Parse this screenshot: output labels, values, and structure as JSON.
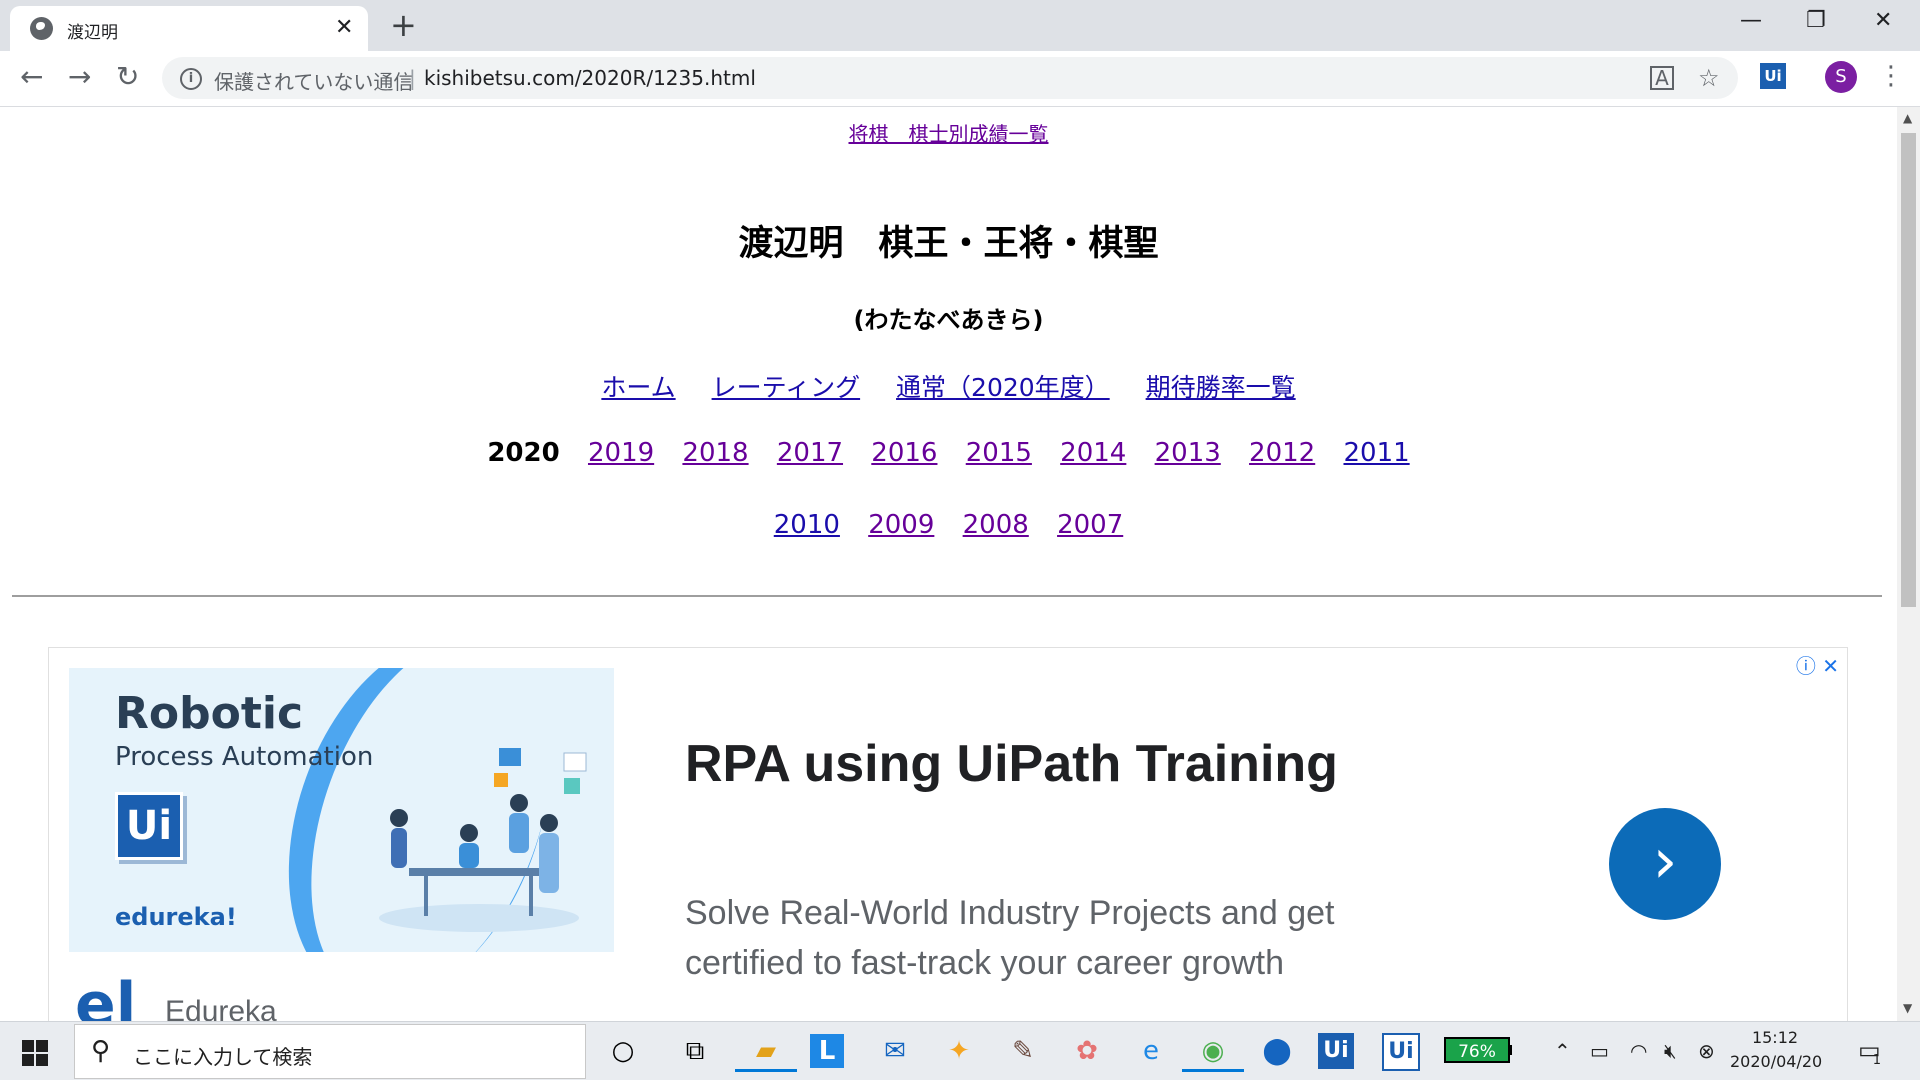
{
  "browser": {
    "tab_title": "渡辺明",
    "tab_close": "✕",
    "new_tab": "+",
    "window_minimize": "—",
    "window_restore": "❐",
    "window_close": "✕",
    "back": "←",
    "forward": "→",
    "reload": "↻",
    "security_text": "保護されていない通信",
    "separator": "|",
    "url": "kishibetsu.com/2020R/1235.html",
    "translate_icon": "translate-icon",
    "bookmark_star": "☆",
    "extension_label": "Ui",
    "avatar_letter": "S",
    "menu": "⋮"
  },
  "page": {
    "top_link": "将棋　棋士別成績一覧",
    "title": "渡辺明　棋王・王将・棋聖",
    "reading": "(わたなべあきら)",
    "nav_links": [
      "ホーム",
      "レーティング",
      "通常（2020年度）",
      "期待勝率一覧"
    ],
    "current_year": "2020",
    "years_row1": [
      "2019",
      "2018",
      "2017",
      "2016",
      "2015",
      "2014",
      "2013",
      "2012",
      "2011"
    ],
    "years_row2": [
      "2010",
      "2009",
      "2008",
      "2007"
    ]
  },
  "ad": {
    "info_close": "ⓘ ✕",
    "image_title": "Robotic",
    "image_subtitle": "Process Automation",
    "image_logo": "Ui",
    "image_brand": "edureka!",
    "headline": "RPA using UiPath Training",
    "description": "Solve Real-World Industry Projects and get certified to fast-track your career growth",
    "arrow": "›",
    "brand_logo": "el",
    "brand_name": "Edureka"
  },
  "taskbar": {
    "search_placeholder": "ここに入力して検索",
    "battery": "76%",
    "time": "15:12",
    "date": "2020/04/20",
    "notification_count": "1"
  },
  "colors": {
    "link": "#1a0dab",
    "visited_link": "#660099",
    "ad_button": "#0c6bb8",
    "accent_taskbar": "#0078d7"
  }
}
